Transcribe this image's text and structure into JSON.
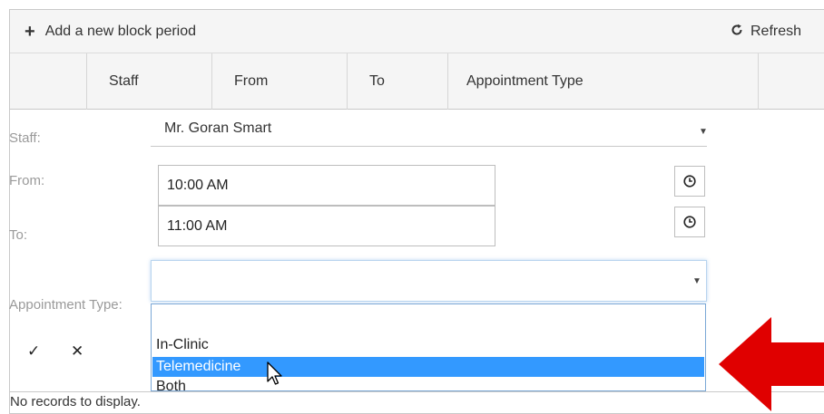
{
  "toolbar": {
    "add_label": "Add a new block period",
    "refresh_label": "Refresh"
  },
  "columns": [
    "",
    "Staff",
    "From",
    "To",
    "Appointment Type",
    ""
  ],
  "form": {
    "staff_label": "Staff:",
    "staff_value": "Mr. Goran Smart",
    "from_label": "From:",
    "from_value": "10:00 AM",
    "to_label": "To:",
    "to_value": "11:00 AM",
    "appt_label": "Appointment Type:",
    "appt_value": ""
  },
  "dropdown": {
    "options": [
      "In-Clinic",
      "Telemedicine",
      "Both"
    ],
    "highlighted": "Telemedicine"
  },
  "empty_message": "No records to display.",
  "colors": {
    "highlight": "#3399ff",
    "arrow": "#e00000",
    "header_bg": "#f5f5f5"
  }
}
